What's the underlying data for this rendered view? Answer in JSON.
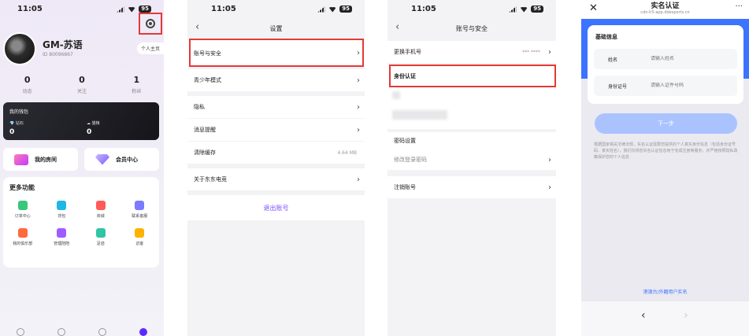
{
  "status": {
    "time": "11:05",
    "battery": "95"
  },
  "profile": {
    "name": "GM-苏语",
    "id": "ID 80096867",
    "home_button": "个人主页",
    "stats": [
      {
        "value": "0",
        "label": "动态"
      },
      {
        "value": "0",
        "label": "关注"
      },
      {
        "value": "1",
        "label": "粉丝"
      }
    ],
    "wallet": {
      "title": "我的钱包",
      "diamond_label": "钻石",
      "diamond_value": "0",
      "coin_label": "猫粮",
      "coin_value": "0"
    },
    "quick": [
      {
        "label": "我的房间"
      },
      {
        "label": "会员中心"
      }
    ],
    "more_title": "更多功能",
    "functions": [
      {
        "label": "订单中心",
        "color": "#39c77a"
      },
      {
        "label": "背包",
        "color": "#1fb7e6"
      },
      {
        "label": "商城",
        "color": "#ff5a5a"
      },
      {
        "label": "联系客服",
        "color": "#7b7bff"
      },
      {
        "label": "我的俱乐部",
        "color": "#ff6a3d"
      },
      {
        "label": "管理陪陪",
        "color": "#a05cff"
      },
      {
        "label": "足迹",
        "color": "#2fc6a5"
      },
      {
        "label": "访客",
        "color": "#ffb300"
      }
    ]
  },
  "settings": {
    "title": "设置",
    "rows": [
      {
        "label": "账号与安全",
        "meta": ""
      },
      {
        "label": "青少年模式",
        "meta": ""
      },
      {
        "label": "隐私",
        "meta": ""
      },
      {
        "label": "消息提醒",
        "meta": ""
      },
      {
        "label": "清除缓存",
        "meta": "4.64 MB"
      },
      {
        "label": "关于东东电竞",
        "meta": ""
      }
    ],
    "logout": "退出账号"
  },
  "security": {
    "title": "账号与安全",
    "phone_label": "更换手机号",
    "phone_value": "*** ****",
    "id_label": "身份认证",
    "password_header": "密码设置",
    "password_row": "修改登录密码",
    "cancel_row": "注销账号"
  },
  "realname": {
    "title": "实名认证",
    "url": "cdn-h5-app.ddesports.cn",
    "section": "基础信息",
    "name_label": "姓名",
    "name_placeholder": "请输入姓名",
    "idcard_label": "身份证号",
    "idcard_placeholder": "请输入证件号码",
    "next": "下一步",
    "notice": "根据国家相关法律法规，实名认证需要您提供的个人真实身份信息（包括身份证号码、真实姓名），我们仅将您实名认证信息用于完成注册等服务，并严格按照隐私政策保护您的个人信息",
    "hk_link": "港澳台/外籍用户实名"
  }
}
